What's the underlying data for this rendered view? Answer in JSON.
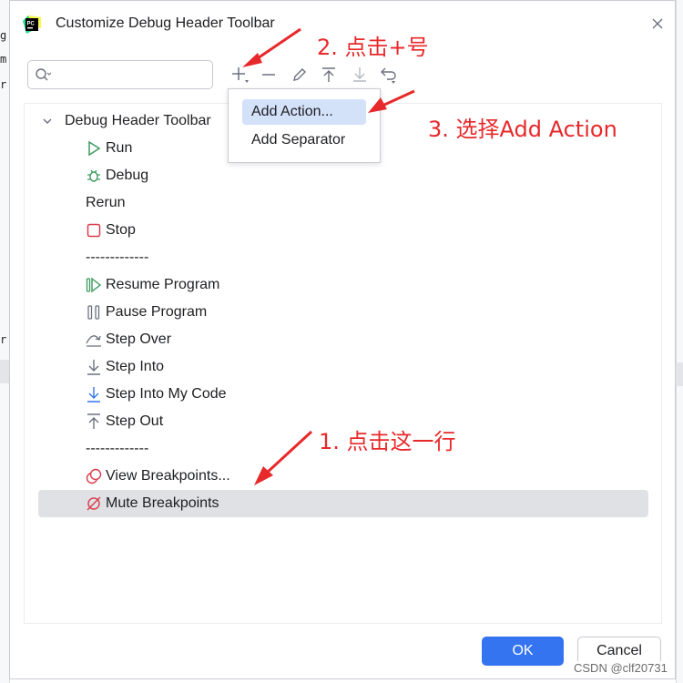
{
  "background": {
    "left_chars": [
      "g",
      "m",
      "r",
      "r"
    ]
  },
  "dialog": {
    "title": "Customize Debug Header Toolbar",
    "app_logo_text": "PC"
  },
  "search": {
    "value": "",
    "placeholder": ""
  },
  "toolbar": {
    "buttons": [
      {
        "name": "add",
        "icon": "plus-icon"
      },
      {
        "name": "remove",
        "icon": "minus-icon"
      },
      {
        "name": "edit",
        "icon": "pencil-icon"
      },
      {
        "name": "move-up",
        "icon": "arrow-up-icon"
      },
      {
        "name": "move-down",
        "icon": "arrow-down-icon"
      },
      {
        "name": "restore",
        "icon": "undo-icon"
      }
    ]
  },
  "tree": {
    "root_label": "Debug Header Toolbar",
    "items": [
      {
        "label": "Run",
        "icon": "run-icon"
      },
      {
        "label": "Debug",
        "icon": "bug-icon"
      },
      {
        "label": "Rerun",
        "icon": ""
      },
      {
        "label": "Stop",
        "icon": "stop-icon"
      },
      {
        "label": "-------------",
        "icon": ""
      },
      {
        "label": "Resume Program",
        "icon": "resume-icon"
      },
      {
        "label": "Pause Program",
        "icon": "pause-icon"
      },
      {
        "label": "Step Over",
        "icon": "step-over-icon"
      },
      {
        "label": "Step Into",
        "icon": "step-into-icon"
      },
      {
        "label": "Step Into My Code",
        "icon": "step-into-my-code-icon"
      },
      {
        "label": "Step Out",
        "icon": "step-out-icon"
      },
      {
        "label": "-------------",
        "icon": ""
      },
      {
        "label": "View Breakpoints...",
        "icon": "view-breakpoints-icon"
      },
      {
        "label": "Mute Breakpoints",
        "icon": "mute-breakpoints-icon"
      }
    ]
  },
  "popup": {
    "items": [
      "Add Action...",
      "Add Separator"
    ]
  },
  "annotations": {
    "step1": "1. 点击这一行",
    "step2": "2. 点击+号",
    "step3": "3. 选择Add Action",
    "color": "#e8292b"
  },
  "footer": {
    "ok_label": "OK",
    "cancel_label": "Cancel"
  },
  "watermark": "CSDN @clf20731",
  "colors": {
    "accent": "#3574f0",
    "selection": "#dfe1e5",
    "popup_highlight": "#d3e1f9",
    "run_green": "#3c9a5f",
    "stop_red": "#db3b4b",
    "step_blue": "#3574f0"
  }
}
